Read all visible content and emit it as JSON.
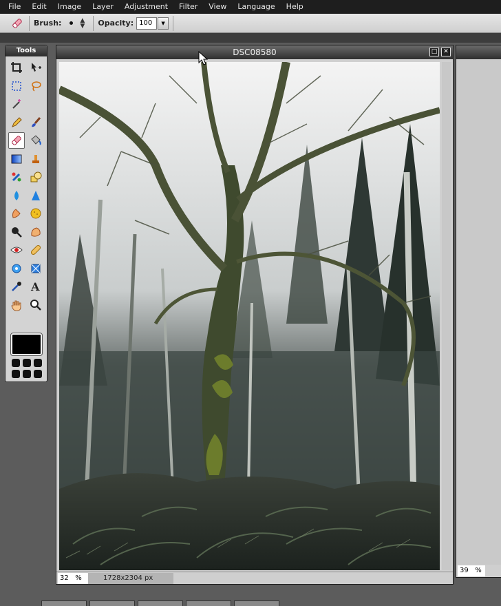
{
  "menu": [
    "File",
    "Edit",
    "Image",
    "Layer",
    "Adjustment",
    "Filter",
    "View",
    "Language",
    "Help"
  ],
  "options": {
    "brush_label": "Brush:",
    "opacity_label": "Opacity:",
    "opacity_value": "100"
  },
  "tools_panel": {
    "title": "Tools",
    "tools": [
      "crop-icon",
      "move-icon",
      "marquee-select-icon",
      "lasso-icon",
      "magic-wand-icon",
      "pencil-icon",
      "brush-icon",
      "eraser-icon",
      "bucket-fill-icon",
      "gradient-icon",
      "clone-stamp-icon",
      "color-replace-icon",
      "draw-shape-icon",
      "blur-icon",
      "sharpen-icon",
      "smudge-icon",
      "sponge-icon",
      "dodge-icon",
      "burn-icon",
      "red-eye-icon",
      "spot-heal-icon",
      "bloat-icon",
      "pinch-icon",
      "color-picker-icon",
      "type-icon",
      "hand-icon",
      "zoom-icon"
    ],
    "active_tool": "eraser-icon",
    "foreground_color": "#000000"
  },
  "image_window": {
    "title": "DSC08580",
    "zoom": "32",
    "zoom_unit": "%",
    "dimensions": "1728x2304 px"
  },
  "second_window": {
    "zoom": "39",
    "zoom_unit": "%"
  }
}
